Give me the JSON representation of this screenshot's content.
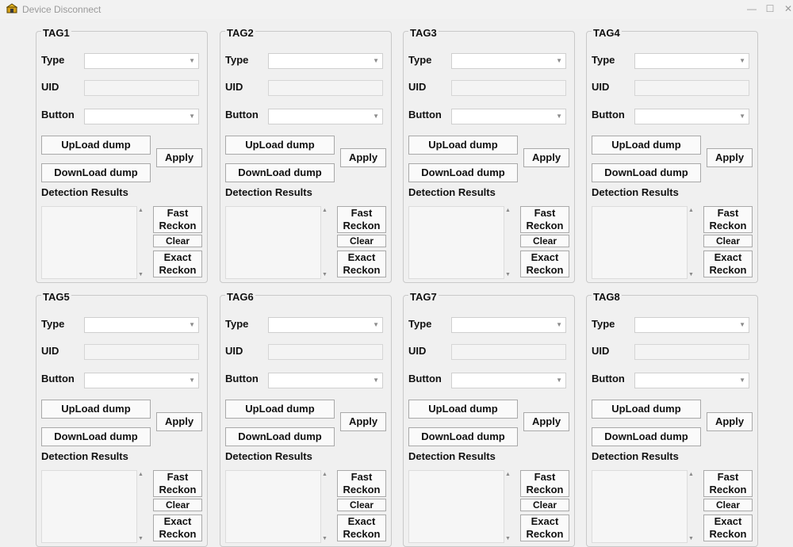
{
  "window": {
    "title": "Device Disconnect",
    "minimize": "—",
    "maximize": "☐",
    "close": "✕"
  },
  "labels": {
    "type": "Type",
    "uid": "UID",
    "button": "Button",
    "upload": "UpLoad dump",
    "download": "DownLoad dump",
    "apply": "Apply",
    "detection": "Detection Results",
    "fast": "Fast\nReckon",
    "clear": "Clear",
    "exact": "Exact\nReckon"
  },
  "tags": [
    {
      "name": "TAG1",
      "type": "",
      "uid": "",
      "button": ""
    },
    {
      "name": "TAG2",
      "type": "",
      "uid": "",
      "button": ""
    },
    {
      "name": "TAG3",
      "type": "",
      "uid": "",
      "button": ""
    },
    {
      "name": "TAG4",
      "type": "",
      "uid": "",
      "button": ""
    },
    {
      "name": "TAG5",
      "type": "",
      "uid": "",
      "button": ""
    },
    {
      "name": "TAG6",
      "type": "",
      "uid": "",
      "button": ""
    },
    {
      "name": "TAG7",
      "type": "",
      "uid": "",
      "button": ""
    },
    {
      "name": "TAG8",
      "type": "",
      "uid": "",
      "button": ""
    }
  ]
}
